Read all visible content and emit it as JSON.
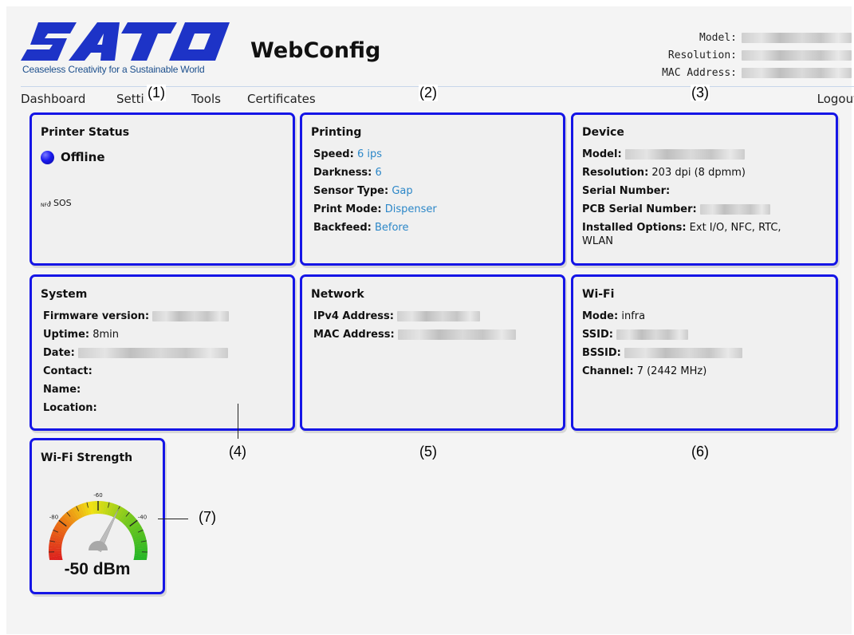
{
  "header": {
    "logo_text": "SATO",
    "tagline": "Ceaseless Creativity for a Sustainable World",
    "app_title": "WebConfig",
    "info": [
      {
        "label": "Model:"
      },
      {
        "label": "Resolution:"
      },
      {
        "label": "MAC Address:"
      }
    ]
  },
  "nav": {
    "items": [
      "Dashboard",
      "Setti",
      "Tools",
      "Certificates"
    ],
    "logout": "Logout"
  },
  "callouts": [
    "(1)",
    "(2)",
    "(3)",
    "(4)",
    "(5)",
    "(6)",
    "(7)"
  ],
  "printer_status": {
    "title": "Printer Status",
    "state": "Offline",
    "state_color": "#1a1aee",
    "nfc_label": "SOS"
  },
  "printing": {
    "title": "Printing",
    "rows": [
      {
        "label": "Speed:",
        "value": "6 ips"
      },
      {
        "label": "Darkness:",
        "value": "6"
      },
      {
        "label": "Sensor Type:",
        "value": "Gap"
      },
      {
        "label": "Print Mode:",
        "value": "Dispenser"
      },
      {
        "label": "Backfeed:",
        "value": "Before"
      }
    ]
  },
  "device": {
    "title": "Device",
    "model_label": "Model:",
    "resolution_label": "Resolution:",
    "resolution_value": "203 dpi (8 dpmm)",
    "serial_label": "Serial Number:",
    "pcb_label": "PCB Serial Number:",
    "options_label": "Installed Options:",
    "options_value_1": "Ext I/O, NFC, RTC,",
    "options_value_2": "WLAN"
  },
  "system": {
    "title": "System",
    "firmware_label": "Firmware version:",
    "uptime_label": "Uptime:",
    "uptime_value": "8min",
    "date_label": "Date:",
    "contact_label": "Contact:",
    "name_label": "Name:",
    "location_label": "Location:"
  },
  "network": {
    "title": "Network",
    "ipv4_label": "IPv4 Address:",
    "mac_label": "MAC Address:"
  },
  "wifi": {
    "title": "Wi-Fi",
    "mode_label": "Mode:",
    "mode_value": "infra",
    "ssid_label": "SSID:",
    "bssid_label": "BSSID:",
    "channel_label": "Channel:",
    "channel_value": "7 (2442 MHz)"
  },
  "wifi_strength": {
    "title": "Wi-Fi Strength",
    "value_text": "-50 dBm",
    "value": -50,
    "min": -100,
    "max": -20,
    "ticks": [
      "-100",
      "-80",
      "-60",
      "-40",
      "-20"
    ]
  },
  "colors": {
    "panel_border": "#1515e6",
    "value_text": "#2c87c8",
    "logo": "#1d33c7"
  }
}
